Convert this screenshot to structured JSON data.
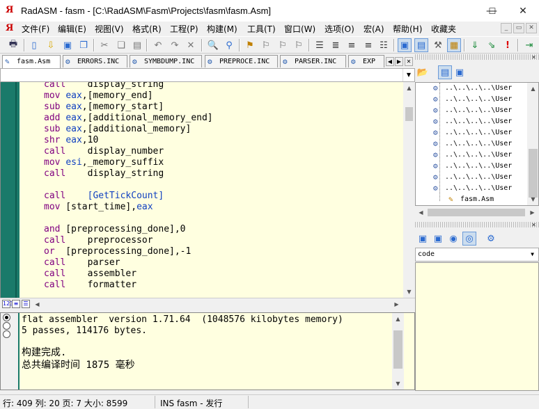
{
  "window": {
    "title": "RadASM - fasm - [C:\\RadASM\\Fasm\\Projects\\fasm\\fasm.Asm]",
    "logo": "Я",
    "minimize": "—",
    "maximize": "☐",
    "close": "✕"
  },
  "menu": {
    "items": [
      "文件(F)",
      "编辑(E)",
      "视图(V)",
      "格式(R)",
      "工程(P)",
      "构建(M)",
      "工具(T)",
      "窗口(W)",
      "选项(O)",
      "宏(A)",
      "帮助(H)",
      "收藏夹"
    ],
    "mdi_min": "_",
    "mdi_restore": "▭",
    "mdi_close": "✕"
  },
  "tabs": [
    {
      "label": "fasm.Asm",
      "icon": "asm-file-icon"
    },
    {
      "label": "ERRORS.INC",
      "icon": "inc-file-icon"
    },
    {
      "label": "SYMBDUMP.INC",
      "icon": "inc-file-icon"
    },
    {
      "label": "PREPROCE.INC",
      "icon": "inc-file-icon"
    },
    {
      "label": "PARSER.INC",
      "icon": "inc-file-icon"
    },
    {
      "label": "EXP",
      "icon": "inc-file-icon"
    }
  ],
  "editor": {
    "lines": [
      [
        {
          "t": "call",
          "c": "kw"
        },
        {
          "t": "    display_string",
          "c": ""
        }
      ],
      [
        {
          "t": "mov",
          "c": "kw"
        },
        {
          "t": " ",
          "c": ""
        },
        {
          "t": "eax",
          "c": "reg"
        },
        {
          "t": ",[memory_end]",
          "c": ""
        }
      ],
      [
        {
          "t": "sub",
          "c": "kw"
        },
        {
          "t": " ",
          "c": ""
        },
        {
          "t": "eax",
          "c": "reg"
        },
        {
          "t": ",[memory_start]",
          "c": ""
        }
      ],
      [
        {
          "t": "add",
          "c": "kw"
        },
        {
          "t": " ",
          "c": ""
        },
        {
          "t": "eax",
          "c": "reg"
        },
        {
          "t": ",[additional_memory_end]",
          "c": ""
        }
      ],
      [
        {
          "t": "sub",
          "c": "kw"
        },
        {
          "t": " ",
          "c": ""
        },
        {
          "t": "eax",
          "c": "reg"
        },
        {
          "t": ",[additional_memory]",
          "c": ""
        }
      ],
      [
        {
          "t": "shr",
          "c": "kw"
        },
        {
          "t": " ",
          "c": ""
        },
        {
          "t": "eax",
          "c": "reg"
        },
        {
          "t": ",10",
          "c": ""
        }
      ],
      [
        {
          "t": "call",
          "c": "kw"
        },
        {
          "t": "    display_number",
          "c": ""
        }
      ],
      [
        {
          "t": "mov",
          "c": "kw"
        },
        {
          "t": " ",
          "c": ""
        },
        {
          "t": "esi",
          "c": "reg"
        },
        {
          "t": ",_memory_suffix",
          "c": ""
        }
      ],
      [
        {
          "t": "call",
          "c": "kw"
        },
        {
          "t": "    display_string",
          "c": ""
        }
      ],
      [],
      [
        {
          "t": "call",
          "c": "kw"
        },
        {
          "t": "    ",
          "c": ""
        },
        {
          "t": "[GetTickCount]",
          "c": "api"
        }
      ],
      [
        {
          "t": "mov",
          "c": "kw"
        },
        {
          "t": " [start_time],",
          "c": ""
        },
        {
          "t": "eax",
          "c": "reg"
        }
      ],
      [],
      [
        {
          "t": "and",
          "c": "kw"
        },
        {
          "t": " [preprocessing_done],0",
          "c": ""
        }
      ],
      [
        {
          "t": "call",
          "c": "kw"
        },
        {
          "t": "    preprocessor",
          "c": ""
        }
      ],
      [
        {
          "t": "or",
          "c": "kw"
        },
        {
          "t": "  [preprocessing_done],-1",
          "c": ""
        }
      ],
      [
        {
          "t": "call",
          "c": "kw"
        },
        {
          "t": "    parser",
          "c": ""
        }
      ],
      [
        {
          "t": "call",
          "c": "kw"
        },
        {
          "t": "    assembler",
          "c": ""
        }
      ],
      [
        {
          "t": "call",
          "c": "kw"
        },
        {
          "t": "    formatter",
          "c": ""
        }
      ]
    ]
  },
  "output": {
    "line1": "flat assembler  version 1.71.64  (1048576 kilobytes memory)",
    "line2": "5 passes, 114176 bytes.",
    "line3": "构建完成.",
    "line4": "总共编译时间 1875 毫秒"
  },
  "project_tree": {
    "items": [
      "..\\..\\..\\..\\User",
      "..\\..\\..\\..\\User",
      "..\\..\\..\\..\\User",
      "..\\..\\..\\..\\User",
      "..\\..\\..\\..\\User",
      "..\\..\\..\\..\\User",
      "..\\..\\..\\..\\User",
      "..\\..\\..\\..\\User",
      "..\\..\\..\\..\\User",
      "..\\..\\..\\..\\User"
    ],
    "selected_file": "fasm.Asm"
  },
  "properties": {
    "combo_value": "code"
  },
  "statusbar": {
    "position": "行: 409  列: 20 页: 7 大小: 8599",
    "mode": "INS fasm - 发行"
  },
  "colors": {
    "editor_bg": "#ffffe0",
    "gutter": "#1a7a6a",
    "keyword": "#800080",
    "register": "#1040c0",
    "logo": "#cc0000"
  }
}
